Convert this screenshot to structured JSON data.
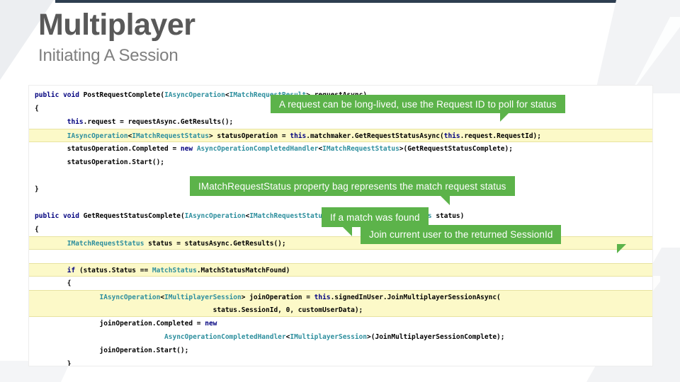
{
  "slide": {
    "title": "Multiplayer",
    "subtitle": "Initiating A Session",
    "accent_green": "#5cb34a",
    "highlight_yellow": "#fcf9c8",
    "title_color": "#595959",
    "subtitle_color": "#7f7f7f",
    "topbar_color": "#2e3e50"
  },
  "callouts": [
    {
      "id": "callout-1",
      "text": "A request can be long-lived, use the Request ID to poll for status"
    },
    {
      "id": "callout-2",
      "text": "IMatchRequestStatus property bag represents the match request status"
    },
    {
      "id": "callout-3",
      "text": "If a match was found"
    },
    {
      "id": "callout-4",
      "text": "Join current user to the returned SessionId"
    }
  ],
  "code": {
    "language": "csharp",
    "lines": [
      {
        "n": 1,
        "highlight": "none",
        "text": "public void PostRequestComplete(IAsyncOperation<IMatchRequestResult> requestAsync)"
      },
      {
        "n": 2,
        "highlight": "none",
        "text": "{"
      },
      {
        "n": 3,
        "highlight": "none",
        "text": "        this.request = requestAsync.GetResults();"
      },
      {
        "n": 4,
        "highlight": "full",
        "text": "        IAsyncOperation<IMatchRequestStatus> statusOperation = this.matchmaker.GetRequestStatusAsync(this.request.RequestId);"
      },
      {
        "n": 5,
        "highlight": "none",
        "text": "        statusOperation.Completed = new AsyncOperationCompletedHandler<IMatchRequestStatus>(GetRequestStatusComplete);"
      },
      {
        "n": 6,
        "highlight": "none",
        "text": "        statusOperation.Start();"
      },
      {
        "n": 7,
        "highlight": "none",
        "text": ""
      },
      {
        "n": 8,
        "highlight": "none",
        "text": "}"
      },
      {
        "n": 9,
        "highlight": "none",
        "text": ""
      },
      {
        "n": 10,
        "highlight": "none",
        "text": "public void GetRequestStatusComplete(IAsyncOperation<IMatchRequestStatus> statusAsync, AsyncStatus status)"
      },
      {
        "n": 11,
        "highlight": "none",
        "text": "{"
      },
      {
        "n": 12,
        "highlight": "full",
        "text": "        IMatchRequestStatus status = statusAsync.GetResults();"
      },
      {
        "n": 13,
        "highlight": "none",
        "text": ""
      },
      {
        "n": 14,
        "highlight": "full",
        "text": "        if (status.Status == MatchStatus.MatchStatusMatchFound)"
      },
      {
        "n": 15,
        "highlight": "none",
        "text": "        {"
      },
      {
        "n": 16,
        "highlight": "top",
        "text": "                IAsyncOperation<IMultiplayerSession> joinOperation = this.signedInUser.JoinMultiplayerSessionAsync("
      },
      {
        "n": 17,
        "highlight": "bot",
        "text": "                                            status.SessionId, 0, customUserData);"
      },
      {
        "n": 18,
        "highlight": "none",
        "text": "                joinOperation.Completed = new"
      },
      {
        "n": 19,
        "highlight": "none",
        "text": "                                AsyncOperationCompletedHandler<IMultiplayerSession>(JoinMultiplayerSessionComplete);"
      },
      {
        "n": 20,
        "highlight": "none",
        "text": "                joinOperation.Start();"
      },
      {
        "n": 21,
        "highlight": "none",
        "text": "        }"
      },
      {
        "n": 22,
        "highlight": "none",
        "text": "}"
      }
    ],
    "tokens": {
      "keywords": [
        "public",
        "void",
        "new",
        "if",
        "this"
      ],
      "types": [
        "IAsyncOperation",
        "IMatchRequestResult",
        "IMatchRequestStatus",
        "IMultiplayerSession",
        "MatchStatus",
        "AsyncStatus",
        "AsyncOperationCompletedHandler"
      ]
    }
  }
}
